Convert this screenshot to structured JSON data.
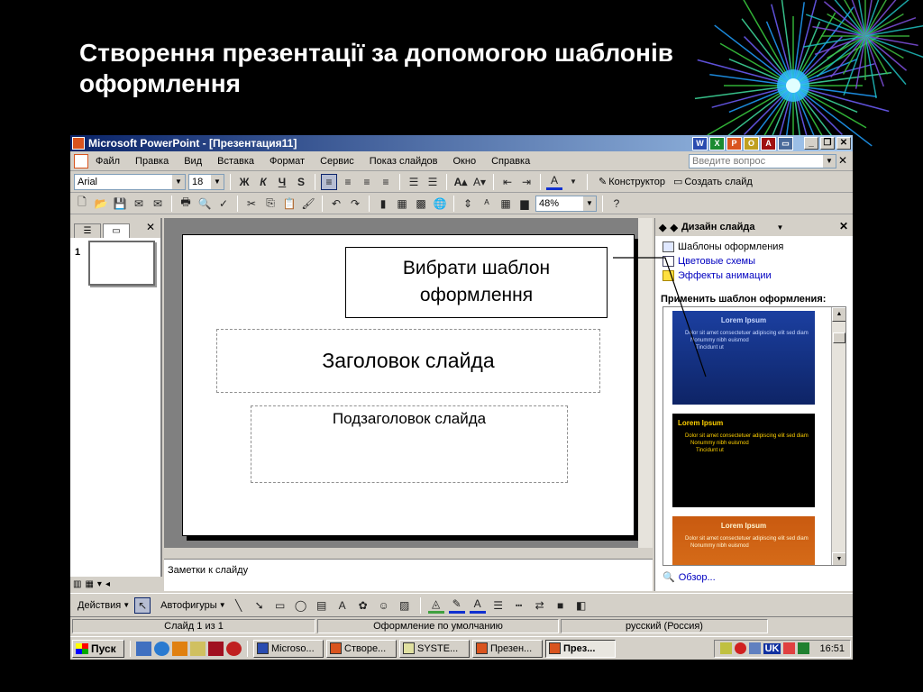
{
  "slide_heading": "Створення презентації за допомогою шаблонів оформлення",
  "window": {
    "title": "Microsoft PowerPoint - [Презентация11]"
  },
  "menu": {
    "items": [
      "Файл",
      "Правка",
      "Вид",
      "Вставка",
      "Формат",
      "Сервис",
      "Показ слайдов",
      "Окно",
      "Справка"
    ],
    "ask_placeholder": "Введите вопрос"
  },
  "format_toolbar": {
    "font": "Arial",
    "size": "18",
    "designer": "Конструктор",
    "new_slide": "Создать слайд"
  },
  "standard_toolbar": {
    "zoom": "48%"
  },
  "slide": {
    "title_placeholder": "Заголовок слайда",
    "subtitle_placeholder": "Подзаголовок слайда"
  },
  "thumbnail": {
    "number": "1"
  },
  "notes_placeholder": "Заметки к слайду",
  "task_pane": {
    "title": "Дизайн слайда",
    "links": [
      "Шаблоны оформления",
      "Цветовые схемы",
      "Эффекты анимации"
    ],
    "apply_label": "Применить шаблон оформления:",
    "browse": "Обзор...",
    "templates": [
      {
        "title": "Lorem Ipsum",
        "bullets": [
          "Dolor sit amet consectetuer adipiscing elit sed diam",
          "Nonummy nibh euismod",
          "Tincidunt ut"
        ]
      },
      {
        "title": "Lorem Ipsum",
        "bullets": [
          "Dolor sit amet consectetuer adipiscing elit sed diam",
          "Nonummy nibh euismod",
          "Tincidunt ut"
        ]
      },
      {
        "title": "Lorem Ipsum",
        "bullets": [
          "Dolor sit amet consectetuer adipiscing elit sed diam",
          "Nonummy nibh euismod"
        ]
      }
    ]
  },
  "drawing_toolbar": {
    "actions": "Действия",
    "autoshapes": "Автофигуры"
  },
  "status": {
    "slide": "Слайд 1 из 1",
    "design": "Оформление по умолчанию",
    "language": "русский (Россия)"
  },
  "taskbar": {
    "start": "Пуск",
    "tasks": [
      "Microso...",
      "Створе...",
      "SYSTE...",
      "Презен...",
      "През..."
    ],
    "tray_lang": "UK",
    "clock": "16:51"
  },
  "callout": {
    "text": "Вибрати шаблон оформлення"
  },
  "colors": {
    "title_bar": "#0a246a",
    "background": "#000000",
    "link": "#0000c0"
  }
}
